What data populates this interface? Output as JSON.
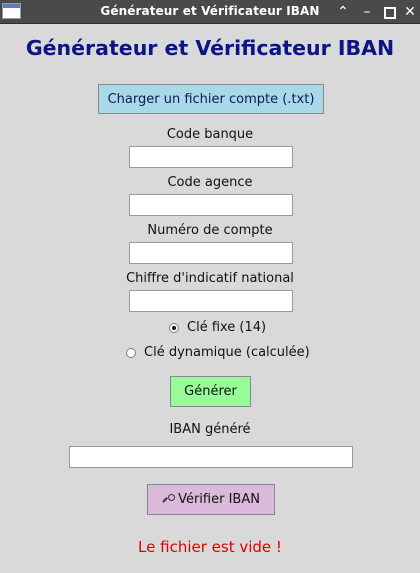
{
  "window": {
    "title": "Générateur et Vérificateur IBAN",
    "controls": [
      "chevron-up-icon",
      "minimize-icon",
      "maximize-icon",
      "close-icon"
    ]
  },
  "heading": "Générateur et Vérificateur IBAN",
  "load_button": {
    "label": "Charger un fichier compte (.txt)"
  },
  "fields": {
    "bank_code": {
      "label": "Code banque",
      "value": ""
    },
    "branch_code": {
      "label": "Code agence",
      "value": ""
    },
    "account_number": {
      "label": "Numéro de compte",
      "value": ""
    },
    "national_check": {
      "label": "Chiffre d'indicatif national",
      "value": ""
    }
  },
  "key_options": [
    {
      "label": "Clé fixe (14)",
      "selected": true
    },
    {
      "label": "Clé dynamique (calculée)",
      "selected": false
    }
  ],
  "generate_button": {
    "label": "Générer"
  },
  "iban_output": {
    "label": "IBAN généré",
    "value": ""
  },
  "verify_button": {
    "label": "Vérifier IBAN",
    "icon": "magnifier-icon"
  },
  "status_message": "Le fichier est vide !",
  "colors": {
    "heading": "#0b1584",
    "load_button_bg": "#a9d8e6",
    "generate_button_bg": "#97fb97",
    "verify_button_bg": "#dab9da",
    "error_text": "#e00000",
    "background": "#d9d9d9"
  }
}
